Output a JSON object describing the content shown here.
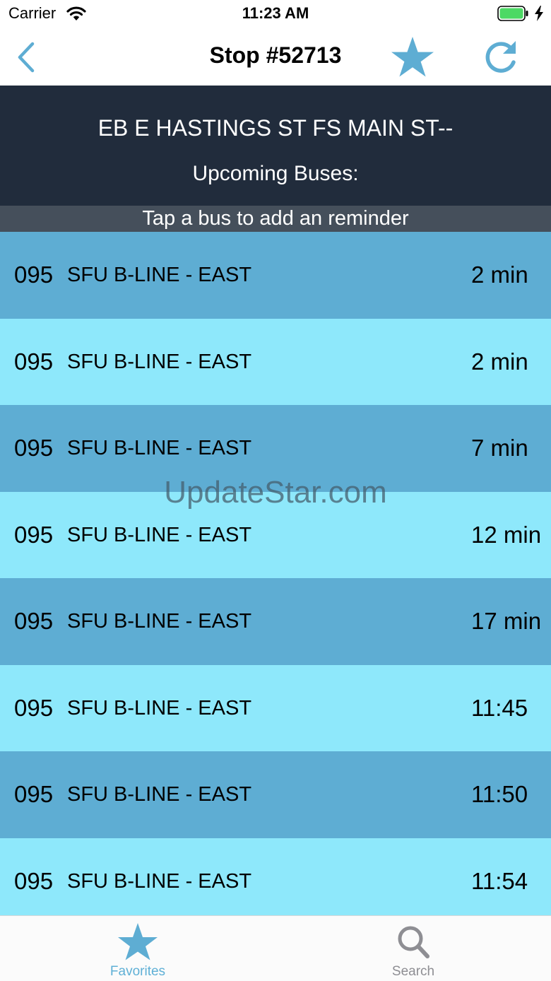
{
  "status_bar": {
    "carrier": "Carrier",
    "time": "11:23 AM"
  },
  "nav": {
    "title": "Stop #52713",
    "accent_color": "#5eadd3"
  },
  "header": {
    "stop_name": "EB E HASTINGS ST FS MAIN ST--",
    "subtitle": "Upcoming Buses:",
    "hint": "Tap a bus to add an reminder"
  },
  "buses": [
    {
      "route": "095",
      "destination": "SFU B-LINE - EAST",
      "eta": "2 min"
    },
    {
      "route": "095",
      "destination": "SFU B-LINE - EAST",
      "eta": "2 min"
    },
    {
      "route": "095",
      "destination": "SFU B-LINE - EAST",
      "eta": "7 min"
    },
    {
      "route": "095",
      "destination": "SFU B-LINE - EAST",
      "eta": "12 min"
    },
    {
      "route": "095",
      "destination": "SFU B-LINE - EAST",
      "eta": "17 min"
    },
    {
      "route": "095",
      "destination": "SFU B-LINE - EAST",
      "eta": "11:45"
    },
    {
      "route": "095",
      "destination": "SFU B-LINE - EAST",
      "eta": "11:50"
    },
    {
      "route": "095",
      "destination": "SFU B-LINE - EAST",
      "eta": "11:54"
    }
  ],
  "watermark": "UpdateStar.com",
  "tabs": [
    {
      "label": "Favorites",
      "icon": "star-icon",
      "selected": true
    },
    {
      "label": "Search",
      "icon": "search-icon",
      "selected": false
    }
  ],
  "colors": {
    "header_bg": "#212c3c",
    "hint_bg": "#454f5b",
    "row_dark": "#5eadd3",
    "row_light": "#8ee8fb",
    "battery": "#4cd964"
  }
}
